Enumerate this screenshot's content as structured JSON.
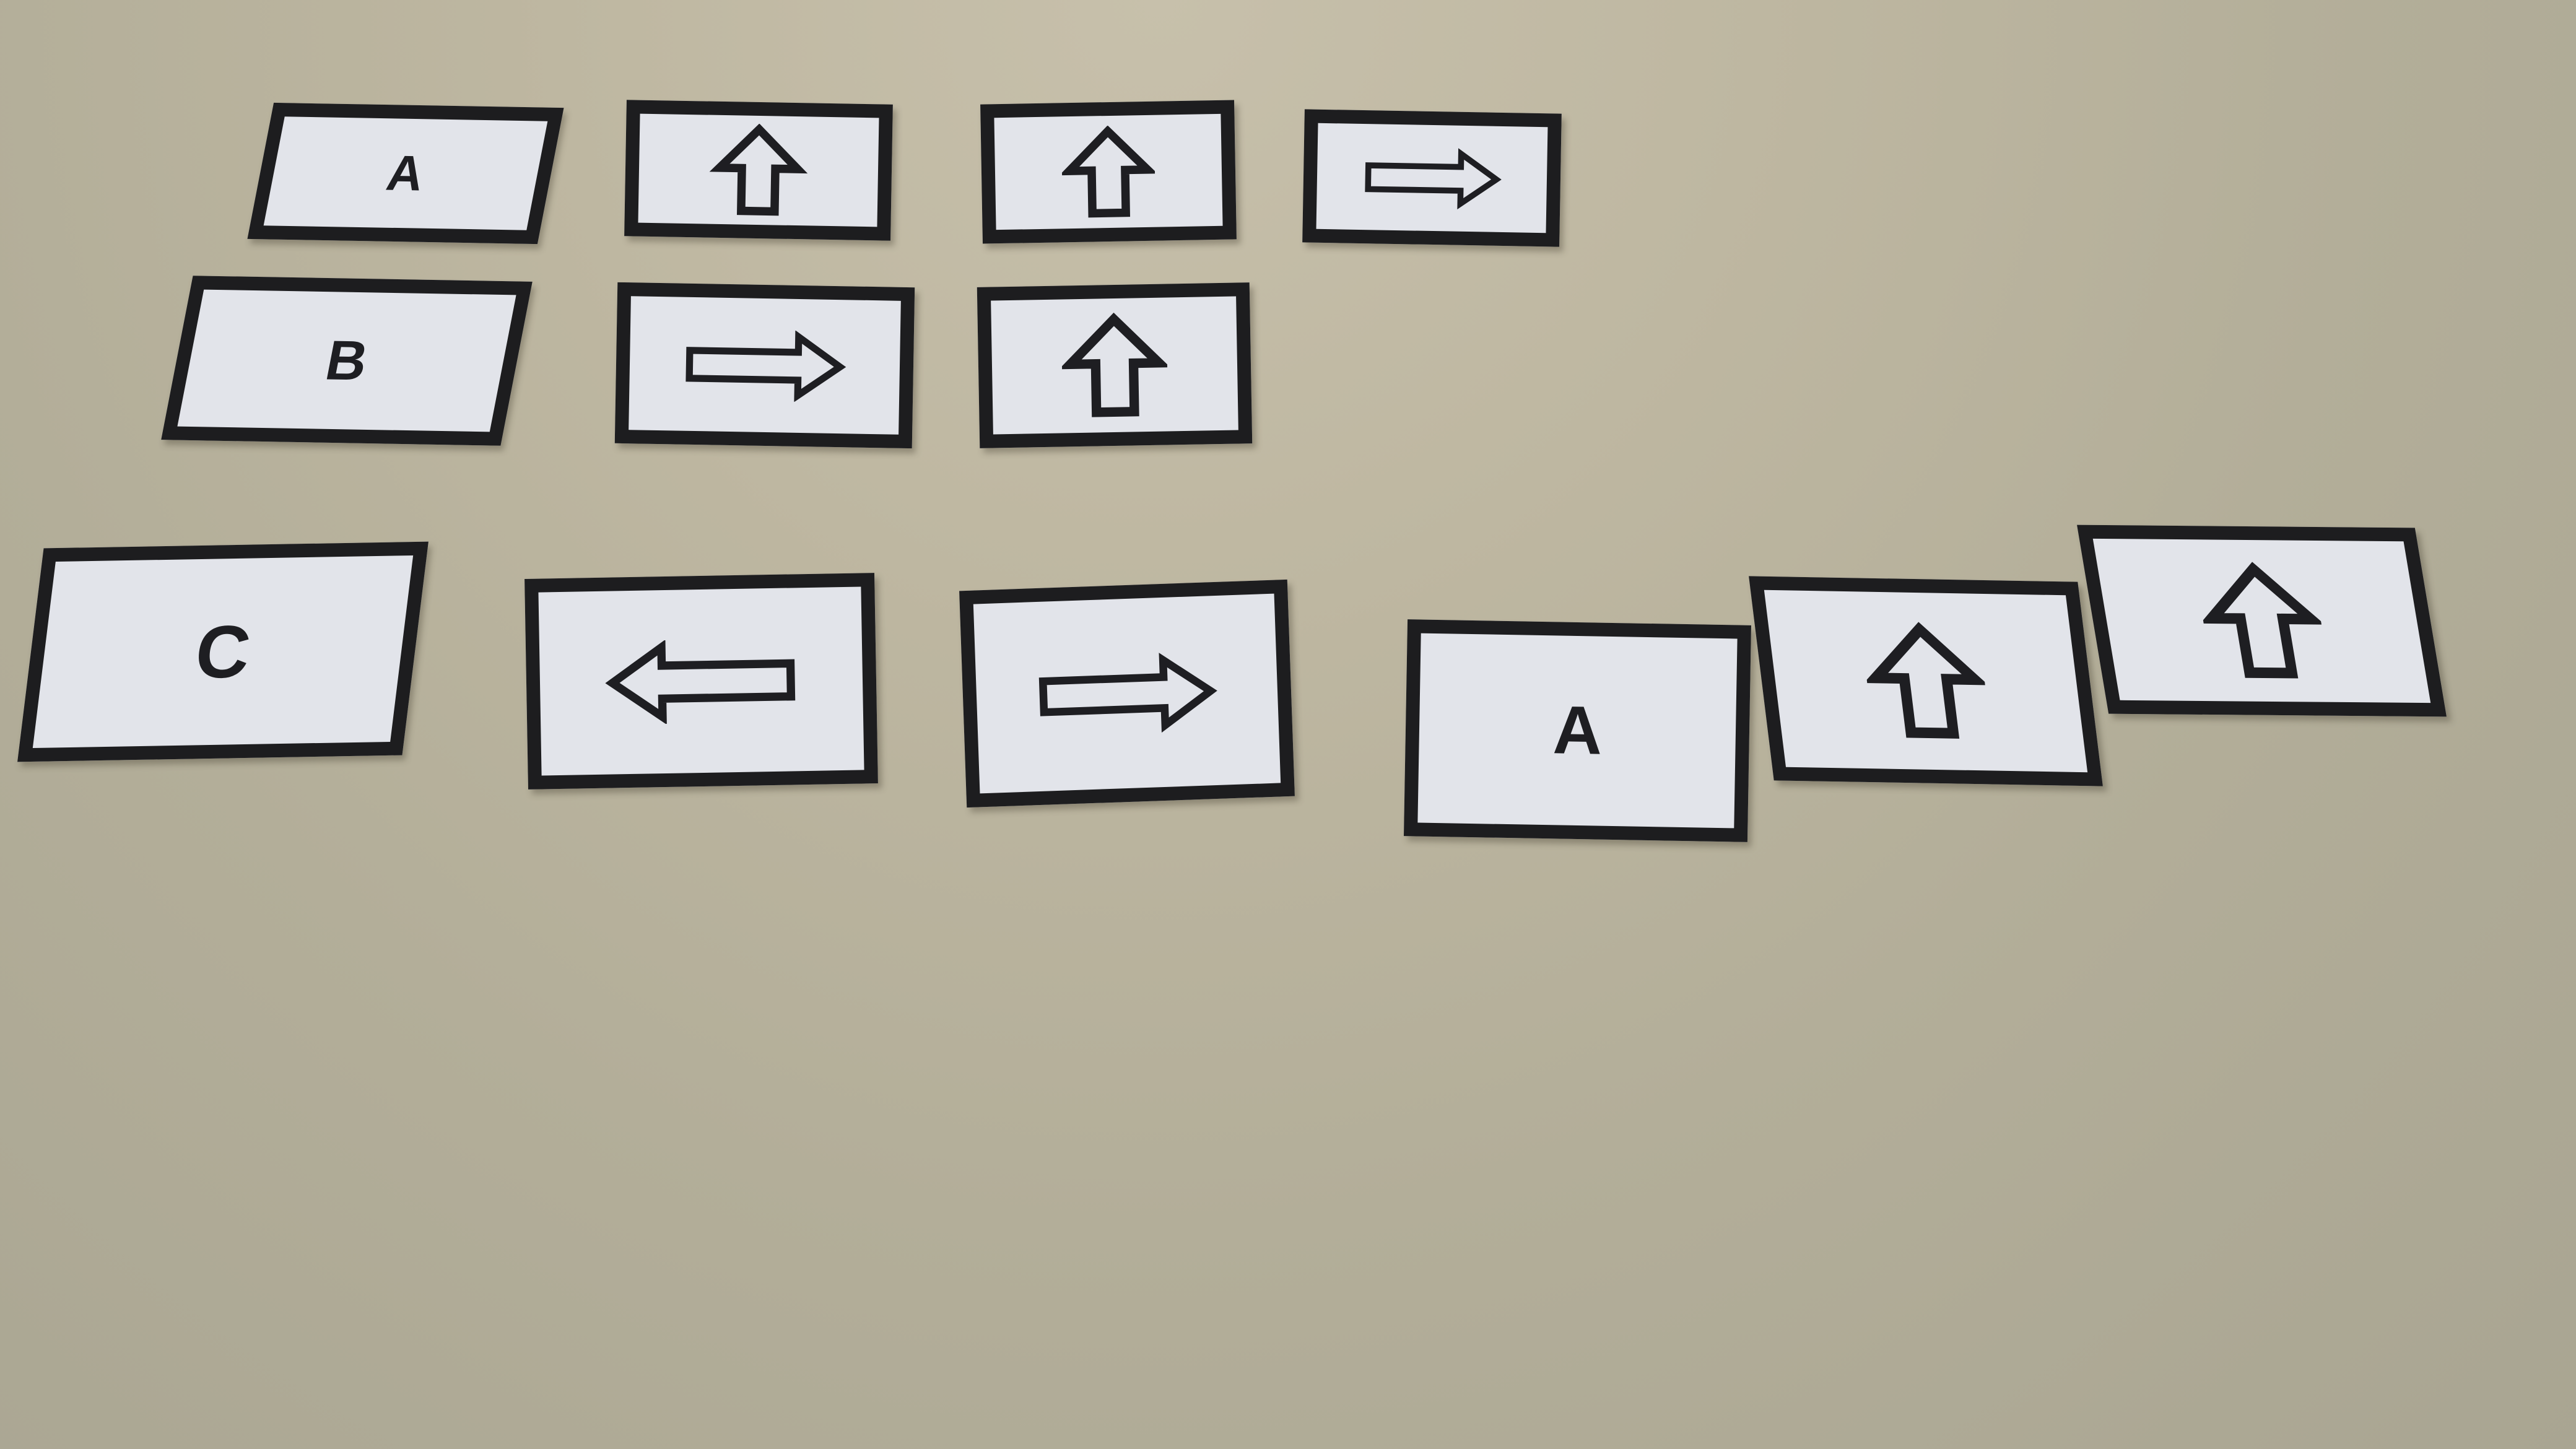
{
  "scene": {
    "wall_color": "#bcb6a0",
    "card_face_color": "#e2e4ea",
    "card_border_color": "#1d1d1f"
  },
  "rows": [
    {
      "cards": [
        {
          "type": "letter",
          "value": "A"
        },
        {
          "type": "arrow",
          "direction": "up",
          "icon": "arrow-up-icon"
        },
        {
          "type": "arrow",
          "direction": "up",
          "icon": "arrow-up-icon"
        },
        {
          "type": "arrow",
          "direction": "right",
          "icon": "arrow-right-icon"
        }
      ]
    },
    {
      "cards": [
        {
          "type": "letter",
          "value": "B"
        },
        {
          "type": "arrow",
          "direction": "right",
          "icon": "arrow-right-icon"
        },
        {
          "type": "arrow",
          "direction": "up",
          "icon": "arrow-up-icon"
        }
      ]
    },
    {
      "cards": [
        {
          "type": "letter",
          "value": "C"
        },
        {
          "type": "arrow",
          "direction": "left",
          "icon": "arrow-left-icon"
        },
        {
          "type": "arrow",
          "direction": "right",
          "icon": "arrow-right-icon"
        },
        {
          "type": "letter",
          "value": "A"
        },
        {
          "type": "arrow",
          "direction": "up",
          "icon": "arrow-up-icon"
        },
        {
          "type": "arrow",
          "direction": "up",
          "icon": "arrow-up-icon"
        }
      ]
    }
  ]
}
